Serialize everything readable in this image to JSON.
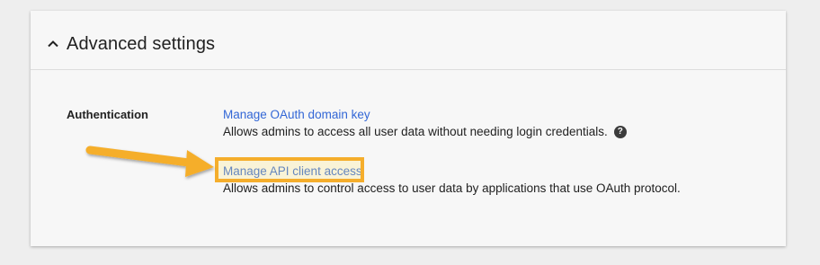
{
  "section": {
    "title": "Advanced settings",
    "toggle_icon": "chevron-up-icon"
  },
  "authentication": {
    "label": "Authentication",
    "settings": [
      {
        "link": "Manage OAuth domain key",
        "description": "Allows admins to access all user data without needing login credentials.",
        "help_icon": "help-icon",
        "help_glyph": "?"
      },
      {
        "link": "Manage API client access",
        "description": "Allows admins to control access to user data by applications that use OAuth protocol."
      }
    ]
  },
  "annotation": {
    "highlight_color": "#f5ae2c",
    "arrow_color": "#f5ae2c"
  },
  "colors": {
    "link": "#3367d6",
    "card_background": "#f7f7f7",
    "page_background": "#eeeeee"
  }
}
